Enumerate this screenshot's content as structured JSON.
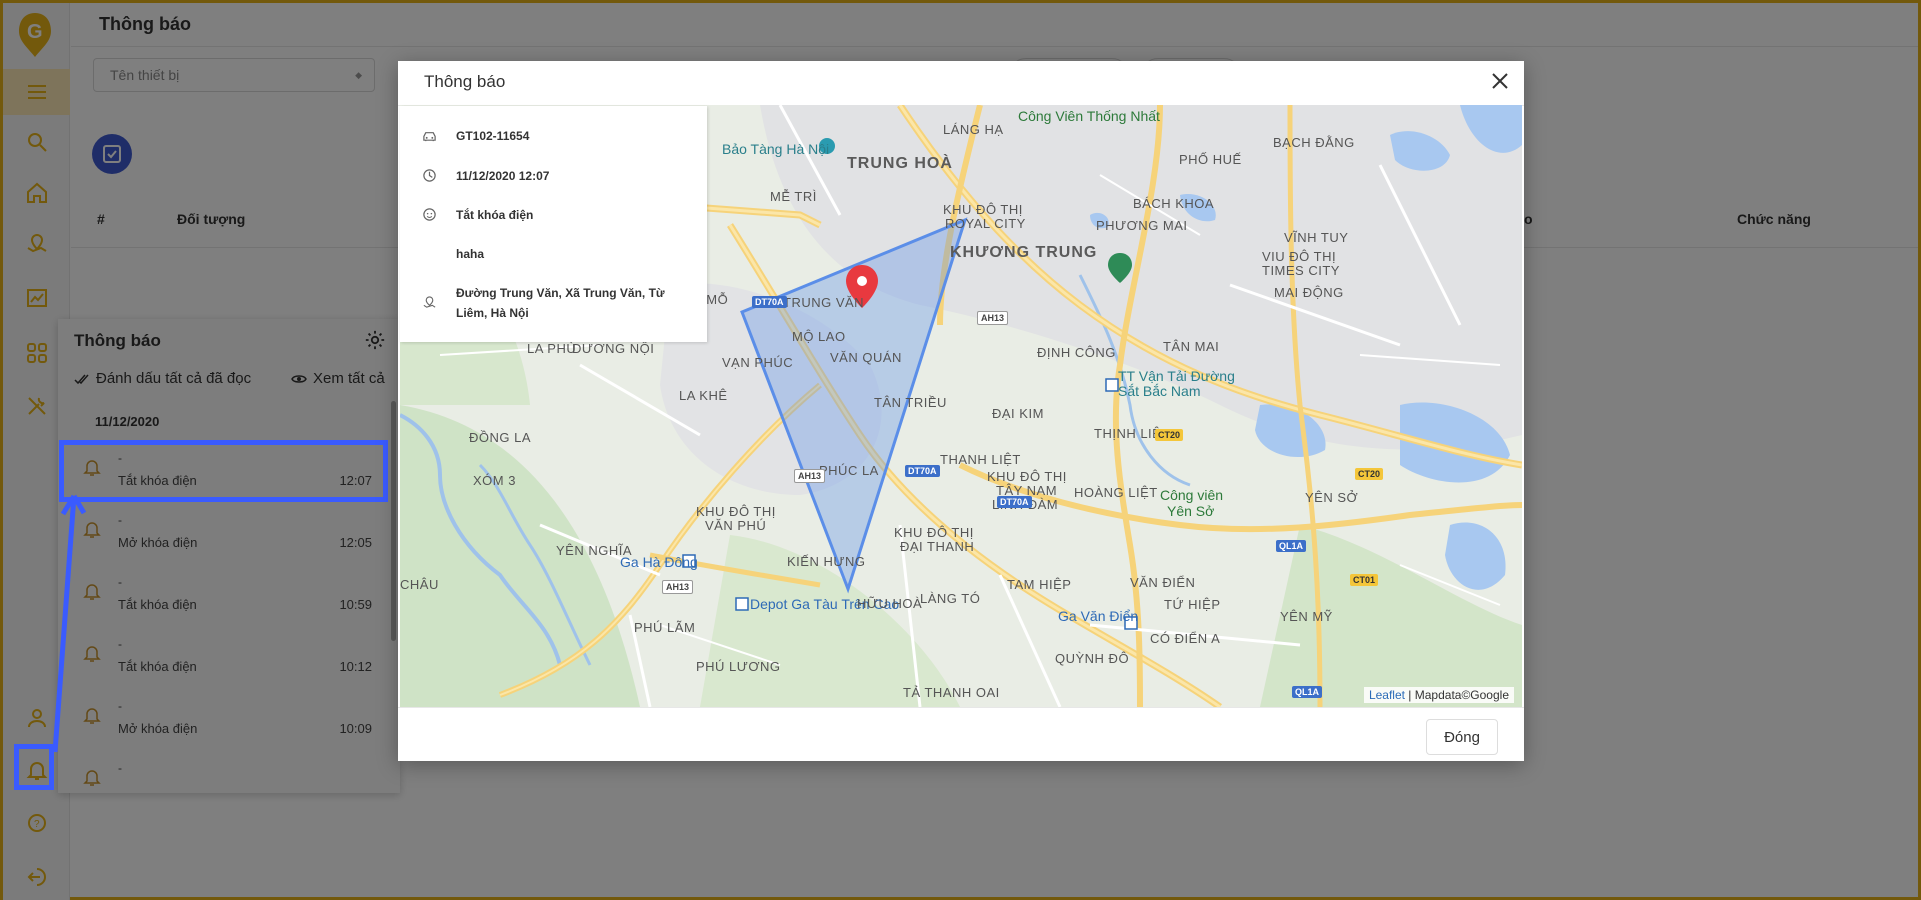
{
  "colors": {
    "accent": "#e6b219",
    "primary_blue": "#3f5bd0",
    "highlight": "#3a5bff",
    "marker": "#e8393f",
    "geofence": "#5b8ee8"
  },
  "sidebar": {
    "logo": "G",
    "items": [
      {
        "icon": "menu-icon"
      },
      {
        "icon": "search-icon"
      },
      {
        "icon": "home-icon"
      },
      {
        "icon": "map-pin-icon"
      },
      {
        "icon": "chart-icon"
      },
      {
        "icon": "apps-icon"
      },
      {
        "icon": "tools-icon"
      },
      {
        "icon": "user-icon"
      },
      {
        "icon": "bell-icon"
      },
      {
        "icon": "help-icon"
      },
      {
        "icon": "logout-icon"
      }
    ]
  },
  "page": {
    "title": "Thông báo",
    "device_placeholder": "Tên thiết bị",
    "columns": [
      "#",
      "Đối tượng",
      "o",
      "Chức năng"
    ]
  },
  "notif_panel": {
    "title": "Thông báo",
    "mark_all_read": "Đánh dấu tất cả đã đọc",
    "view_all": "Xem tất cả",
    "date": "11/12/2020",
    "items": [
      {
        "title": "-",
        "desc": "Tắt khóa điện",
        "time": "12:07"
      },
      {
        "title": "-",
        "desc": "Mở khóa điện",
        "time": "12:05"
      },
      {
        "title": "-",
        "desc": "Tắt khóa điện",
        "time": "10:59"
      },
      {
        "title": "-",
        "desc": "Tắt khóa điện",
        "time": "10:12"
      },
      {
        "title": "-",
        "desc": "Mở khóa điện",
        "time": "10:09"
      },
      {
        "title": "-",
        "desc": "",
        "time": ""
      }
    ]
  },
  "modal": {
    "title": "Thông báo",
    "close_label": "Đóng",
    "info": {
      "plate": "GT102-11654",
      "datetime": "11/12/2020 12:07",
      "event": "Tắt khóa điện",
      "note": "haha",
      "address": "Đường Trung Văn, Xã Trung Văn, Từ Liêm, Hà Nội"
    },
    "attribution_link": "Leaflet",
    "attribution_text": " | Mapdata©Google"
  },
  "map_labels": {
    "lang_ha": "LÁNG HẠ",
    "cv_thong_nhat": "Công Viên Thống Nhất",
    "bao_tang": "Bảo Tàng Hà Nội",
    "trung_hoa": "TRUNG HOÀ",
    "me_tri": "MỄ TRÌ",
    "khu_do_thi_royal": "KHU ĐÔ THỊ",
    "royal_city": "ROYAL CITY",
    "khuong_trung": "KHƯƠNG TRUNG",
    "pho_hue": "PHỐ HUẾ",
    "bach_dang": "BẠCH ĐẰNG",
    "bach_khoa": "BÁCH KHOA",
    "phuong_mai": "PHƯƠNG MAI",
    "vinh_tuy": "VĨNH TUY",
    "vin_1": "VIU ĐÔ THỊ",
    "vin_2": "TIMES CITY",
    "mai_dong": "MAI ĐỘNG",
    "dai_mo": "ĐẠI MỖ",
    "trung_van": "TRUNG VĂN",
    "mo_lao": "MỘ LAO",
    "van_quan": "VĂN QUÁN",
    "la_phu": "LA PHÙ",
    "duong_noi": "DƯƠNG NỘI",
    "van_phuc": "VẠN PHÚC",
    "la_khe": "LA KHÊ",
    "tan_trieu": "TÂN TRIỀU",
    "dinh_cong": "ĐỊNH CÔNG",
    "tan_mai": "TÂN MAI",
    "tt_van_tai": "TT Vận Tải Đường",
    "sat_bac_nam": "Sắt Bắc Nam",
    "dai_kim": "ĐẠI KIM",
    "thinh_liet": "THỊNH LIỆT",
    "dong_la": "ĐỒNG LA",
    "xom_3": "XÓM 3",
    "phuc_la": "PHÚC LA",
    "thanh_liet": "THANH LIỆT",
    "kdt_tay_nam": "KHU ĐÔ THỊ",
    "tay_nam_2": "TÂY NAM",
    "linh_dam": "LINH ĐÀM",
    "hoang_liet": "HOÀNG LIỆT",
    "cv_yen_so": "Công viên",
    "cv_yen_so_2": "Yên Sở",
    "yen_so": "YÊN SỞ",
    "kdt_van_phu": "KHU ĐÔ THỊ",
    "van_phu_2": "VĂN PHÚ",
    "kdt_dai_thanh": "KHU ĐÔ THỊ",
    "dai_thanh_2": "ĐẠI THANH",
    "yen_nghia": "YÊN NGHĨA",
    "ga_ha_dong": "Ga Hà Đông",
    "kien_hung": "KIẾN HƯNG",
    "depot": "Depot Ga Tàu Trên Cao",
    "tam_hiep": "TAM HIỆP",
    "van_dien": "VĂN ĐIỂN",
    "chau": "CHÂU",
    "huu_hoa": "HỮU HOÀ",
    "lang_to": "LÀNG TÓ",
    "tu_hiep": "TỨ HIỆP",
    "yen_my": "YÊN MỸ",
    "ga_van_dien": "Ga Văn Điển",
    "co_dien_a": "CÓ ĐIỂN A",
    "phu_lam": "PHÚ LÃM",
    "phu_luong": "PHÚ LƯƠNG",
    "quynh_do": "QUỲNH ĐÔ",
    "ta_thanh_oai": "TẢ THANH OAI",
    "dt70a": "DT70A",
    "ah13": "AH13",
    "ct20": "CT20",
    "ql1a": "QL1A",
    "ct01": "CT01"
  }
}
